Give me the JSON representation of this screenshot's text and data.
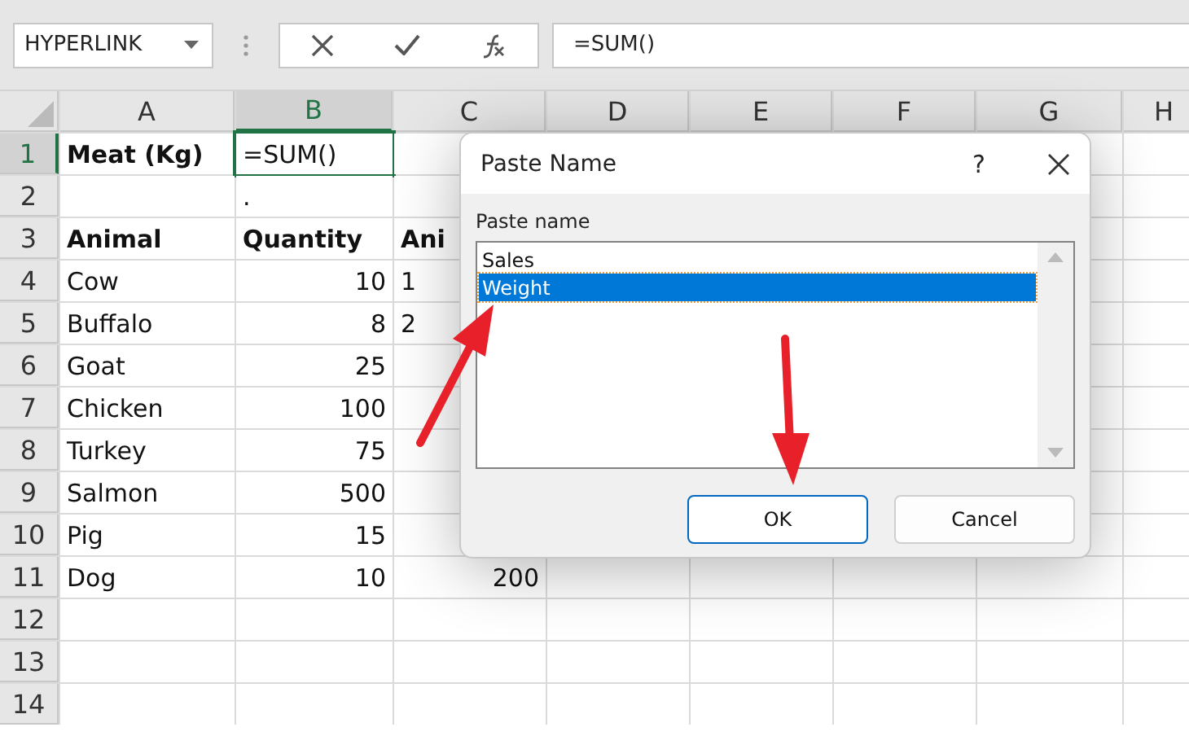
{
  "name_box": {
    "value": "HYPERLINK"
  },
  "formula_bar": {
    "value": "=SUM()"
  },
  "columns": [
    {
      "label": "A",
      "selected": false
    },
    {
      "label": "B",
      "selected": true
    },
    {
      "label": "C",
      "selected": false
    },
    {
      "label": "D",
      "selected": false
    },
    {
      "label": "E",
      "selected": false
    },
    {
      "label": "F",
      "selected": false
    },
    {
      "label": "G",
      "selected": false
    },
    {
      "label": "H",
      "selected": false
    }
  ],
  "rows": [
    {
      "label": "1",
      "selected": true,
      "cells": {
        "a": {
          "text": "Meat (Kg)",
          "bold": true
        },
        "b": {
          "text": "=SUM()"
        }
      }
    },
    {
      "label": "2",
      "selected": false,
      "cells": {
        "b": {
          "text": "."
        }
      }
    },
    {
      "label": "3",
      "selected": false,
      "cells": {
        "a": {
          "text": "Animal",
          "bold": true
        },
        "b": {
          "text": "Quantity",
          "bold": true
        },
        "c": {
          "text": "Ani",
          "bold": true
        }
      }
    },
    {
      "label": "4",
      "selected": false,
      "cells": {
        "a": {
          "text": "Cow"
        },
        "b": {
          "text": "10",
          "kind": "number"
        },
        "c": {
          "text": "1"
        }
      }
    },
    {
      "label": "5",
      "selected": false,
      "cells": {
        "a": {
          "text": "Buffalo"
        },
        "b": {
          "text": "8",
          "kind": "number"
        },
        "c": {
          "text": "2"
        }
      }
    },
    {
      "label": "6",
      "selected": false,
      "cells": {
        "a": {
          "text": "Goat"
        },
        "b": {
          "text": "25",
          "kind": "number"
        }
      }
    },
    {
      "label": "7",
      "selected": false,
      "cells": {
        "a": {
          "text": "Chicken"
        },
        "b": {
          "text": "100",
          "kind": "number"
        }
      }
    },
    {
      "label": "8",
      "selected": false,
      "cells": {
        "a": {
          "text": "Turkey"
        },
        "b": {
          "text": "75",
          "kind": "number"
        }
      }
    },
    {
      "label": "9",
      "selected": false,
      "cells": {
        "a": {
          "text": "Salmon"
        },
        "b": {
          "text": "500",
          "kind": "number"
        }
      }
    },
    {
      "label": "10",
      "selected": false,
      "cells": {
        "a": {
          "text": "Pig"
        },
        "b": {
          "text": "15",
          "kind": "number"
        }
      }
    },
    {
      "label": "11",
      "selected": false,
      "cells": {
        "a": {
          "text": "Dog"
        },
        "b": {
          "text": "10",
          "kind": "number"
        },
        "c": {
          "text": "200",
          "kind": "number"
        }
      }
    },
    {
      "label": "12",
      "selected": false,
      "cells": {}
    },
    {
      "label": "13",
      "selected": false,
      "cells": {}
    },
    {
      "label": "14",
      "selected": false,
      "cells": {}
    }
  ],
  "dialog": {
    "title": "Paste Name",
    "help": "?",
    "label": "Paste name",
    "items": [
      {
        "label": "Sales",
        "selected": false
      },
      {
        "label": "Weight",
        "selected": true
      }
    ],
    "buttons": [
      {
        "label": "OK",
        "kind": "default"
      },
      {
        "label": "Cancel",
        "kind": "normal"
      }
    ]
  }
}
